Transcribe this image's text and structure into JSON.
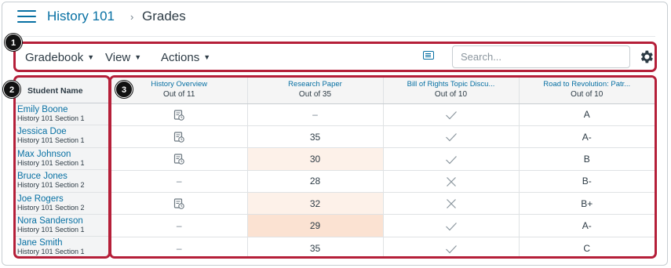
{
  "header": {
    "course_link": "History 101",
    "separator": "›",
    "page_title": "Grades"
  },
  "toolbar": {
    "gradebook_label": "Gradebook",
    "view_label": "View",
    "actions_label": "Actions",
    "search_placeholder": "Search...",
    "icons": [
      "hamburger-menu-icon",
      "keyboard-shortcuts-icon",
      "gear-icon"
    ]
  },
  "callouts": [
    "1",
    "2",
    "3"
  ],
  "student_header": "Student Name",
  "students": [
    {
      "name": "Emily Boone",
      "section": "History 101 Section 1"
    },
    {
      "name": "Jessica Doe",
      "section": "History 101 Section 1"
    },
    {
      "name": "Max Johnson",
      "section": "History 101 Section 1"
    },
    {
      "name": "Bruce Jones",
      "section": "History 101 Section 2"
    },
    {
      "name": "Joe Rogers",
      "section": "History 101 Section 2"
    },
    {
      "name": "Nora Sanderson",
      "section": "History 101 Section 1"
    },
    {
      "name": "Jane Smith",
      "section": "History 101 Section 1"
    }
  ],
  "columns": [
    {
      "title": "History Overview",
      "points": "Out of 11"
    },
    {
      "title": "Research Paper",
      "points": "Out of 35"
    },
    {
      "title": "Bill of Rights Topic Discu...",
      "points": "Out of 10"
    },
    {
      "title": "Road to Revolution: Patr...",
      "points": "Out of 10"
    }
  ],
  "grades": [
    [
      {
        "kind": "submitted-icon"
      },
      {
        "kind": "text",
        "value": "–"
      },
      {
        "kind": "check-icon"
      },
      {
        "kind": "text",
        "value": "A"
      }
    ],
    [
      {
        "kind": "submitted-icon"
      },
      {
        "kind": "text",
        "value": "35"
      },
      {
        "kind": "check-icon"
      },
      {
        "kind": "text",
        "value": "A-"
      }
    ],
    [
      {
        "kind": "submitted-icon"
      },
      {
        "kind": "text",
        "value": "30",
        "highlight": "late"
      },
      {
        "kind": "check-icon"
      },
      {
        "kind": "text",
        "value": "B"
      }
    ],
    [
      {
        "kind": "text",
        "value": "–"
      },
      {
        "kind": "text",
        "value": "28"
      },
      {
        "kind": "x-icon"
      },
      {
        "kind": "text",
        "value": "B-"
      }
    ],
    [
      {
        "kind": "submitted-icon"
      },
      {
        "kind": "text",
        "value": "32",
        "highlight": "late"
      },
      {
        "kind": "x-icon"
      },
      {
        "kind": "text",
        "value": "B+"
      }
    ],
    [
      {
        "kind": "text",
        "value": "–"
      },
      {
        "kind": "text",
        "value": "29",
        "highlight": "late-strong"
      },
      {
        "kind": "check-icon"
      },
      {
        "kind": "text",
        "value": "A-"
      }
    ],
    [
      {
        "kind": "text",
        "value": "–"
      },
      {
        "kind": "text",
        "value": "35"
      },
      {
        "kind": "check-icon"
      },
      {
        "kind": "text",
        "value": "C"
      }
    ]
  ],
  "colors": {
    "link": "#0770a3",
    "callout_border": "#b51f39",
    "late_highlight": "#fdf1e9",
    "late_strong_highlight": "#fbe2d2"
  }
}
